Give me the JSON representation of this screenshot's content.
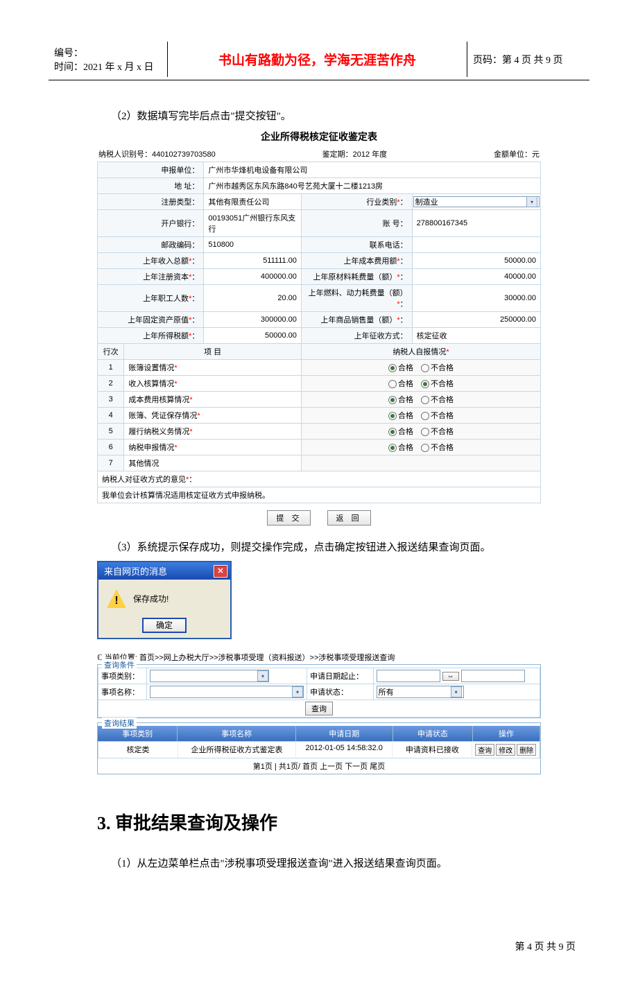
{
  "doc": {
    "id_label": "编号：",
    "date_label": "时间：2021 年 x 月 x 日",
    "headline": "书山有路勤为径，学海无涯苦作舟",
    "page_label": "页码：第 4 页 共 9 页",
    "footer": "第 4 页 共 9 页"
  },
  "para": {
    "p2": "（2）数据填写完毕后点击\"提交按钮\"。",
    "p3": "（3）系统提示保存成功，则提交操作完成，点击确定按钮进入报送结果查询页面。",
    "p4": "（1）从左边菜单栏点击\"涉税事项受理报送查询\"进入报送结果查询页面。"
  },
  "form": {
    "title": "企业所得税核定征收鉴定表",
    "meta_left": "纳税人识别号：440102739703580",
    "meta_mid": "鉴定期：2012 年度",
    "meta_right": "金额单位：元",
    "rows": {
      "shenbao_lbl": "申报单位：",
      "shenbao_val": "广州市华烽机电设备有限公司",
      "addr_lbl": "地 址：",
      "addr_val": "广州市越秀区东风东路840号艺苑大厦十二楼1213房",
      "regtype_lbl": "注册类型：",
      "regtype_val": "其他有限责任公司",
      "industry_lbl": "行业类别",
      "industry_val": "制造业",
      "bank_lbl": "开户银行：",
      "bank_val": "00193051广州银行东风支行",
      "account_lbl": "账 号：",
      "account_val": "278800167345",
      "zip_lbl": "邮政编码：",
      "zip_val": "510800",
      "tel_lbl": "联系电话：",
      "tel_val": "",
      "income_lbl": "上年收入总额",
      "income_val": "511111.00",
      "cost_lbl": "上年成本费用额",
      "cost_val": "50000.00",
      "capital_lbl": "上年注册资本",
      "capital_val": "400000.00",
      "material_lbl": "上年原材料耗费量（额）",
      "material_val": "40000.00",
      "workers_lbl": "上年职工人数",
      "workers_val": "20.00",
      "fuel_lbl": "上年燃料、动力耗费量（额）",
      "fuel_val": "30000.00",
      "asset_lbl": "上年固定资产原值",
      "asset_val": "300000.00",
      "sales_lbl": "上年商品销售量（额）",
      "sales_val": "250000.00",
      "tax_lbl": "上年所得税额",
      "tax_val": "50000.00",
      "method_lbl": "上年征收方式：",
      "method_val": "核定征收"
    },
    "section": {
      "hc": "行次",
      "xm": "项 目",
      "report": "纳税人自报情况"
    },
    "items": [
      {
        "n": "1",
        "name": "账簿设置情况",
        "ok": true
      },
      {
        "n": "2",
        "name": "收入核算情况",
        "ok": false
      },
      {
        "n": "3",
        "name": "成本费用核算情况",
        "ok": true
      },
      {
        "n": "4",
        "name": "账簿、凭证保存情况",
        "ok": true
      },
      {
        "n": "5",
        "name": "履行纳税义务情况",
        "ok": true
      },
      {
        "n": "6",
        "name": "纳税申报情况",
        "ok": true
      },
      {
        "n": "7",
        "name": "其他情况",
        "ok": null
      }
    ],
    "opt_ok": "合格",
    "opt_no": "不合格",
    "opinion_lbl": "纳税人对征收方式的意见",
    "opinion_val": "我单位会计核算情况适用核定征收方式申报纳税。",
    "btn_submit": "提 交",
    "btn_back": "返 回"
  },
  "dialog": {
    "title": "来自网页的消息",
    "msg": "保存成功!",
    "ok": "确定"
  },
  "query": {
    "breadcrumb": "当前位置: 首页>>网上办税大厅>>涉税事项受理（资料报送）>>涉税事项受理报送查询",
    "cond_legend": "查询条件",
    "result_legend": "查询结果",
    "type_lbl": "事项类别：",
    "date_lbl": "申请日期起止：",
    "name_lbl": "事项名称：",
    "status_lbl": "申请状态：",
    "status_val": "所有",
    "search_btn": "查询",
    "cols": {
      "c1": "事项类别",
      "c2": "事项名称",
      "c3": "申请日期",
      "c4": "申请状态",
      "c5": "操作"
    },
    "row": {
      "c1": "核定类",
      "c2": "企业所得税征收方式鉴定表",
      "c3": "2012-01-05 14:58:32.0",
      "c4": "申请资料已接收"
    },
    "ops": {
      "view": "查询",
      "edit": "修改",
      "del": "删除"
    },
    "pager": "第1页 | 共1页/ 首页 上一页 下一页 尾页"
  },
  "section3": {
    "title": "3. 审批结果查询及操作"
  }
}
